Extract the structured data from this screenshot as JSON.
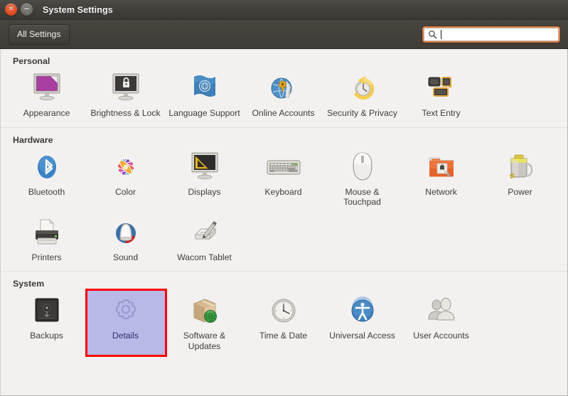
{
  "window": {
    "title": "System Settings",
    "close_glyph": "✕",
    "minimize_glyph": "−"
  },
  "toolbar": {
    "all_settings_label": "All Settings",
    "search": {
      "value": "",
      "placeholder": "",
      "icon": "search-icon"
    }
  },
  "colors": {
    "titlebar": "#413e3a",
    "toolbar": "#433f3a",
    "content_bg": "#f2f1f0",
    "selection_bg": "#b9b9e8",
    "selection_text": "#2e2e6e",
    "annotation": "#fe0000",
    "close_button": "#df4c20",
    "search_focus_ring": "#dd7539"
  },
  "sections": [
    {
      "title": "Personal",
      "items": [
        {
          "label": "Appearance",
          "icon": "appearance-icon",
          "selected": false
        },
        {
          "label": "Brightness & Lock",
          "icon": "brightness-lock-icon",
          "selected": false
        },
        {
          "label": "Language Support",
          "icon": "language-support-icon",
          "selected": false
        },
        {
          "label": "Online Accounts",
          "icon": "online-accounts-icon",
          "selected": false
        },
        {
          "label": "Security & Privacy",
          "icon": "security-privacy-icon",
          "selected": false
        },
        {
          "label": "Text Entry",
          "icon": "text-entry-icon",
          "selected": false
        }
      ]
    },
    {
      "title": "Hardware",
      "items": [
        {
          "label": "Bluetooth",
          "icon": "bluetooth-icon",
          "selected": false
        },
        {
          "label": "Color",
          "icon": "color-icon",
          "selected": false
        },
        {
          "label": "Displays",
          "icon": "displays-icon",
          "selected": false
        },
        {
          "label": "Keyboard",
          "icon": "keyboard-icon",
          "selected": false
        },
        {
          "label": "Mouse & Touchpad",
          "icon": "mouse-touchpad-icon",
          "selected": false
        },
        {
          "label": "Network",
          "icon": "network-icon",
          "selected": false
        },
        {
          "label": "Power",
          "icon": "power-icon",
          "selected": false
        },
        {
          "label": "Printers",
          "icon": "printers-icon",
          "selected": false
        },
        {
          "label": "Sound",
          "icon": "sound-icon",
          "selected": false
        },
        {
          "label": "Wacom Tablet",
          "icon": "wacom-tablet-icon",
          "selected": false
        }
      ]
    },
    {
      "title": "System",
      "items": [
        {
          "label": "Backups",
          "icon": "backups-icon",
          "selected": false
        },
        {
          "label": "Details",
          "icon": "details-icon",
          "selected": true
        },
        {
          "label": "Software & Updates",
          "icon": "software-updates-icon",
          "selected": false
        },
        {
          "label": "Time & Date",
          "icon": "time-date-icon",
          "selected": false
        },
        {
          "label": "Universal Access",
          "icon": "universal-access-icon",
          "selected": false
        },
        {
          "label": "User Accounts",
          "icon": "user-accounts-icon",
          "selected": false
        }
      ]
    }
  ]
}
